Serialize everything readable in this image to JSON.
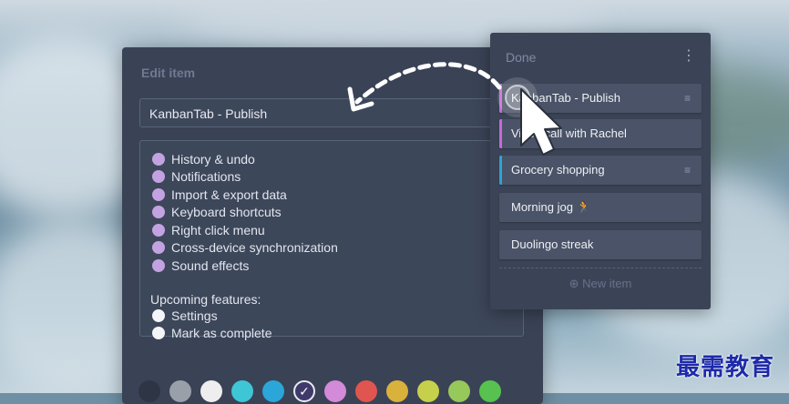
{
  "edit_item": {
    "title": "Edit item",
    "item_title_value": "KanbanTab - Publish",
    "features": [
      {
        "label": "History & undo",
        "dot": "purple"
      },
      {
        "label": "Notifications",
        "dot": "purple"
      },
      {
        "label": "Import & export data",
        "dot": "purple"
      },
      {
        "label": "Keyboard shortcuts",
        "dot": "purple"
      },
      {
        "label": "Right click menu",
        "dot": "purple"
      },
      {
        "label": "Cross-device synchronization",
        "dot": "purple"
      },
      {
        "label": "Sound effects",
        "dot": "purple"
      }
    ],
    "upcoming_label": "Upcoming features:",
    "upcoming": [
      {
        "label": "Settings",
        "dot": "white"
      },
      {
        "label": "Mark as complete",
        "dot": "white"
      }
    ],
    "swatches": [
      "#2e3545",
      "#9aa0aa",
      "#eeeeee",
      "#3fc6d6",
      "#2ba6d8",
      "selected",
      "#d38ad8",
      "#e0554f",
      "#d8b23b",
      "#c7d04a",
      "#97c85a",
      "#57c24f"
    ],
    "selected_check": "✓"
  },
  "done_list": {
    "title": "Done",
    "menu_icon": "kebab-menu-icon",
    "menu_glyph": "⋮",
    "handle_glyph": "≡",
    "cards": [
      {
        "label": "KanbanTab - Publish",
        "accent": "#c86ad8",
        "handle": true
      },
      {
        "label": "Video call with Rachel",
        "accent": "#c86ad8",
        "handle": false
      },
      {
        "label": "Grocery shopping",
        "accent": "#2ea2d6",
        "handle": true
      },
      {
        "label": "Morning jog 🏃",
        "accent": "",
        "handle": false
      },
      {
        "label": "Duolingo streak",
        "accent": "",
        "handle": false
      }
    ],
    "new_item_label": "⊕ New item"
  },
  "watermark": "最需教育"
}
